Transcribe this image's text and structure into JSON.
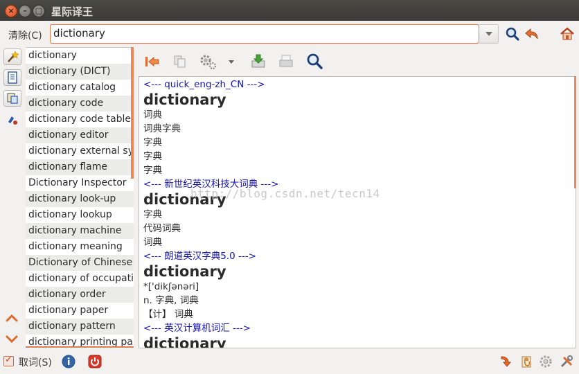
{
  "window": {
    "title": "星际译王"
  },
  "window_controls": {
    "close_glyph": "×",
    "minimize_glyph": "–",
    "maximize_glyph": "□"
  },
  "search": {
    "clear_label": "清除(C)",
    "query": "dictionary"
  },
  "word_list": [
    "dictionary",
    "dictionary (DICT)",
    "dictionary catalog",
    "dictionary code",
    "dictionary code table",
    "dictionary editor",
    "dictionary external symbol",
    "dictionary flame",
    "Dictionary Inspector",
    "dictionary look-up",
    "dictionary lookup",
    "dictionary machine",
    "dictionary meaning",
    "Dictionary of Chinese Proverbs",
    "dictionary of occupational titles",
    "dictionary order",
    "dictionary paper",
    "dictionary pattern",
    "dictionary printing paper"
  ],
  "definitions": [
    {
      "header": "<--- quick_eng-zh_CN --->",
      "word": "dictionary",
      "lines": [
        "词典",
        "词典字典",
        "字典",
        "字典",
        "字典"
      ]
    },
    {
      "header": "<--- 新世纪英汉科技大词典 --->",
      "word": "dictionary",
      "lines": [
        "字典",
        "代码词典",
        "词典"
      ]
    },
    {
      "header": "<--- 朗道英汉字典5.0 --->",
      "word": "dictionary",
      "lines": [
        "*['dikʃənəri]",
        "n. 字典, 词典",
        "【计】 词典"
      ]
    },
    {
      "header": "<--- 英汉计算机词汇 --->",
      "word": "dictionary",
      "lines": []
    }
  ],
  "watermark": "http://blog.csdn.net/tecn14",
  "status": {
    "scan_label": "取词(S)",
    "scan_checked": true
  },
  "colors": {
    "accent": "#e07a4f",
    "dict_header": "#1414b4",
    "titlebar": "#3c3b37"
  },
  "icons": {
    "top": [
      "search-icon",
      "back-arrow-icon",
      "home-icon"
    ],
    "sidebar": [
      "wand-icon",
      "book-list-icon",
      "translate-icon",
      "pen-icon"
    ],
    "toolbar": [
      "go-first-icon",
      "copy-icon",
      "gear-icon",
      "save-icon",
      "print-icon",
      "find-icon"
    ],
    "nav": [
      "scroll-up-icon",
      "scroll-down-icon"
    ],
    "bottom_left": [
      "info-icon",
      "power-icon"
    ],
    "bottom_right": [
      "arrow-down-icon",
      "hand-icon",
      "settings-icon",
      "tools-icon"
    ]
  }
}
